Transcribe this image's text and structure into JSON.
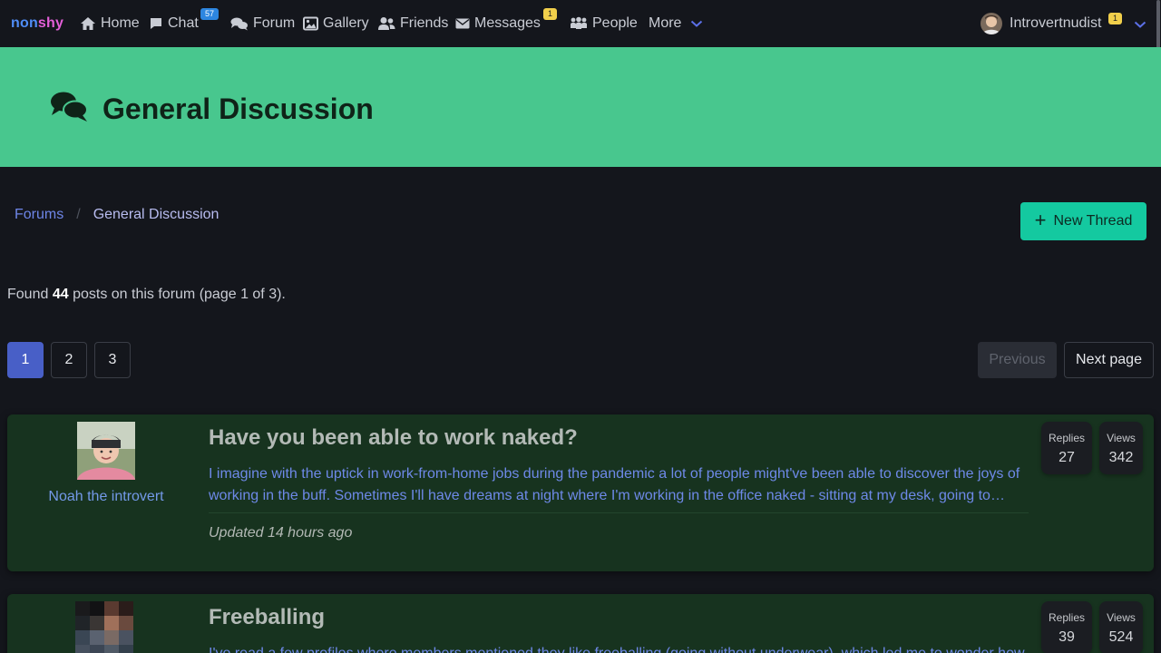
{
  "nav": {
    "brand_part1": "non",
    "brand_part2": "shy",
    "items": [
      {
        "label": "Home",
        "icon": "home-icon"
      },
      {
        "label": "Chat",
        "icon": "chat-icon",
        "badge": "57"
      },
      {
        "label": "Forum",
        "icon": "forum-icon"
      },
      {
        "label": "Gallery",
        "icon": "image-icon"
      },
      {
        "label": "Friends",
        "icon": "friends-icon"
      },
      {
        "label": "Messages",
        "icon": "envelope-icon",
        "badge": "1"
      },
      {
        "label": "People",
        "icon": "people-icon"
      },
      {
        "label": "More",
        "icon": "chevron-down-icon"
      }
    ],
    "user": {
      "name": "Introvertnudist",
      "badge": "1"
    }
  },
  "hero": {
    "title": "General Discussion",
    "icon": "comments-icon"
  },
  "breadcrumb": {
    "items": [
      "Forums",
      "General Discussion"
    ]
  },
  "new_thread_label": "New Thread",
  "summary": {
    "prefix": "Found",
    "count": "44",
    "suffix": "posts on this forum (page 1 of 3)."
  },
  "pagination": {
    "pages": [
      "1",
      "2",
      "3"
    ],
    "current": "1",
    "previous": "Previous",
    "next": "Next page"
  },
  "threads": [
    {
      "title": "Have you been able to work naked?",
      "author": "Noah the introvert",
      "snippet_line1": "I imagine with the uptick in work-from-home jobs during the pandemic a lot of people might've been able to discover the joys of",
      "snippet_line2": "working in the buff. Sometimes I'll have dreams at night where I'm working in the office naked - sitting at my desk, going to…",
      "updated": "Updated 14 hours ago",
      "replies_label": "Replies",
      "replies": "27",
      "views_label": "Views",
      "views": "342"
    },
    {
      "title": "Freeballing",
      "author": "",
      "snippet_line1": "I've read a few profiles where members mentioned they like freeballing (going without underwear), which led me to wonder how",
      "replies_label": "Replies",
      "replies": "39",
      "views_label": "Views",
      "views": "524"
    }
  ],
  "colors": {
    "hero_bg": "#48c78e",
    "accent_button": "#14c9a0",
    "active_page": "#485fc7",
    "card_bg": "#17331f"
  }
}
